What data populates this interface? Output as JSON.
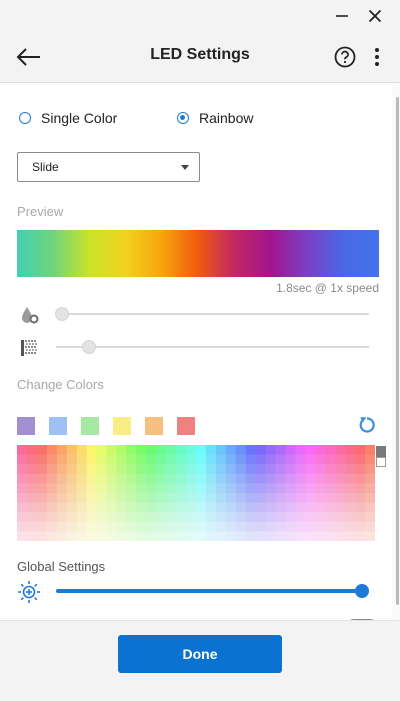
{
  "window": {
    "minimize_icon": "minimize-icon",
    "close_icon": "close-icon"
  },
  "header": {
    "title": "LED Settings",
    "back_icon": "back-arrow-icon",
    "help_icon": "help-icon",
    "more_icon": "more-vertical-icon"
  },
  "mode": {
    "options": [
      {
        "label": "Single Color",
        "selected": false
      },
      {
        "label": "Rainbow",
        "selected": true
      }
    ]
  },
  "effect": {
    "selected": "Slide"
  },
  "preview": {
    "label": "Preview",
    "caption": "1.8sec @ 1x speed",
    "gradient": [
      "#43cfb2",
      "#6fd57b",
      "#c8e32a",
      "#f2d21f",
      "#f6a50b",
      "#f05a0f",
      "#c22763",
      "#a2148c",
      "#7c3fc5",
      "#4a67e4",
      "#4373ea"
    ]
  },
  "sliders": {
    "brightness": {
      "icon": "drop-icon",
      "value": 0.0
    },
    "speed": {
      "icon": "pattern-icon",
      "value": 0.09
    }
  },
  "change_colors": {
    "label": "Change Colors",
    "swatches": [
      "#a28ed0",
      "#9ec0f5",
      "#a7e8a2",
      "#f9ee84",
      "#f7bf7f",
      "#ef8181"
    ],
    "reset_icon": "reset-icon"
  },
  "global_settings": {
    "label": "Global Settings",
    "brightness_icon": "sun-brightness-icon",
    "brightness_value": 1.0
  },
  "colors": {
    "accent": "#1f7ad6",
    "button": "#0a72d1"
  },
  "footer": {
    "done_label": "Done"
  }
}
